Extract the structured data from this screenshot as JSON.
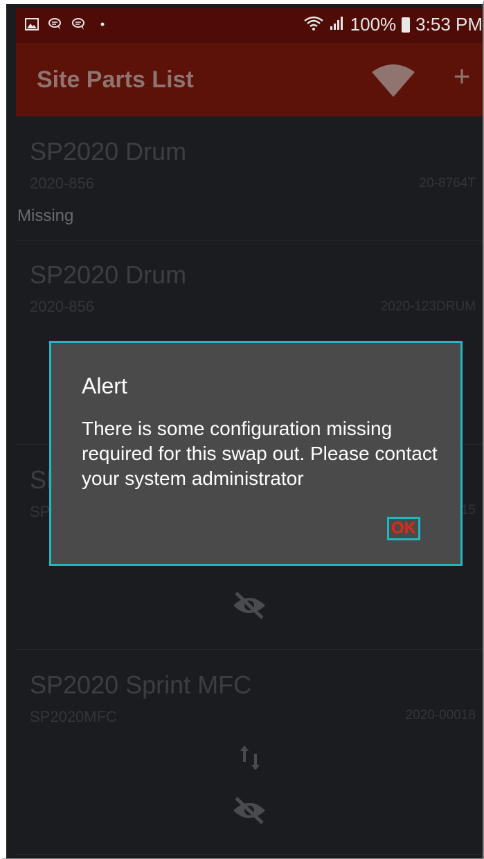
{
  "status_bar": {
    "battery": "100%",
    "time": "3:53 PM"
  },
  "app_bar": {
    "title": "Site Parts List",
    "add_label": "+"
  },
  "list": {
    "items": [
      {
        "name": "SP2020 Drum",
        "sub": "2020-856",
        "serial": "20-8764T",
        "status": "Missing"
      },
      {
        "name": "SP2020 Drum",
        "sub": "2020-856",
        "serial": "2020-123DRUM"
      },
      {
        "name": "SP",
        "sub": "SP",
        "serial": "15"
      },
      {
        "name": "SP2020 Sprint MFC",
        "sub": "SP2020MFC",
        "serial": "2020-00018"
      }
    ]
  },
  "dialog": {
    "title": "Alert",
    "message": "There is some configuration missing required for this swap out. Please contact your system administrator",
    "ok_label": "OK"
  },
  "colors": {
    "status_bar": "#4f0c06",
    "app_bar": "#5c1208",
    "background": "#1b1c1f",
    "dialog": "#4a4a4a",
    "highlight": "#20b8c0",
    "ok_text": "#e02a17"
  }
}
